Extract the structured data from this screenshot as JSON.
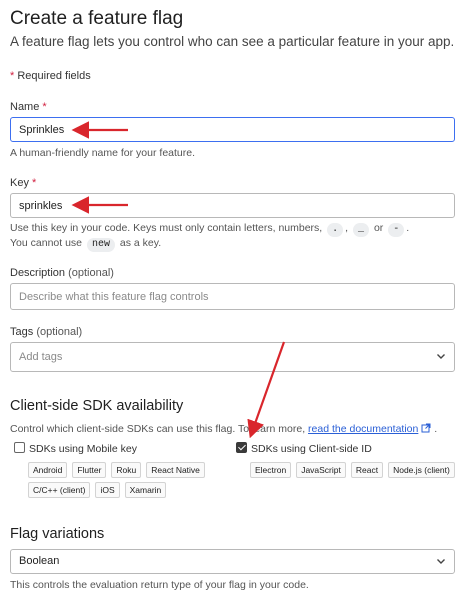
{
  "header": {
    "title": "Create a feature flag",
    "subtitle": "A feature flag lets you control who can see a particular feature in your app."
  },
  "required_note": {
    "star": "*",
    "text": "Required fields"
  },
  "name_field": {
    "label": "Name",
    "required_star": "*",
    "value": "Sprinkles",
    "hint": "A human-friendly name for your feature."
  },
  "key_field": {
    "label": "Key",
    "required_star": "*",
    "value": "sprinkles",
    "hint_line1_pre": "Use this key in your code. Keys must only contain letters, numbers,",
    "allowed_chars": [
      ".",
      "_",
      "-"
    ],
    "sep1": ",",
    "sep2": "or",
    "end": ".",
    "hint_line2_pre": "You cannot use",
    "reserved": "new",
    "hint_line2_post": "as a key."
  },
  "description_field": {
    "label": "Description",
    "optional": "(optional)",
    "placeholder": "Describe what this feature flag controls"
  },
  "tags_field": {
    "label": "Tags",
    "optional": "(optional)",
    "placeholder": "Add tags"
  },
  "sdk_section": {
    "title": "Client-side SDK availability",
    "description": "Control which client-side SDKs can use this flag. To learn more,",
    "link_text": "read the documentation",
    "mobile": {
      "label": "SDKs using Mobile key",
      "checked": false,
      "tags": [
        "Android",
        "Flutter",
        "Roku",
        "React Native",
        "C/C++ (client)",
        "iOS",
        "Xamarin"
      ]
    },
    "client": {
      "label": "SDKs using Client-side ID",
      "checked": true,
      "tags": [
        "Electron",
        "JavaScript",
        "React",
        "Node.js (client)"
      ]
    }
  },
  "variations": {
    "title": "Flag variations",
    "selected": "Boolean",
    "hint": "This controls the evaluation return type of your flag in your code."
  },
  "colors": {
    "accent": "#3d6ff0",
    "required": "#d11f3f",
    "annotation": "#d9262c",
    "link": "#2a5fd6"
  }
}
